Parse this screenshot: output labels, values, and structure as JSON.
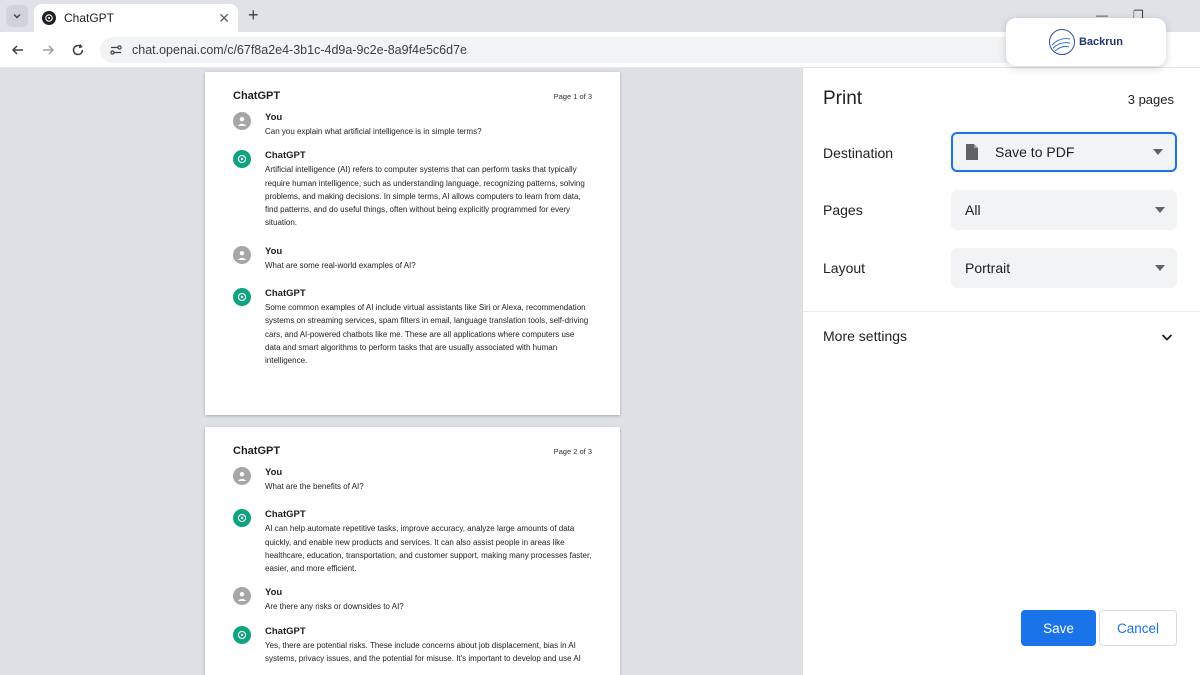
{
  "browser": {
    "tab_title": "ChatGPT",
    "close_glyph": "✕",
    "new_tab_glyph": "+",
    "url": "chat.openai.com/c/67f8a2e4-3b1c-4d9a-9c2e-8a9f4e5c6d7e",
    "minimize_glyph": "—",
    "restore_glyph": "❐"
  },
  "overlay": {
    "brand": "Backrun"
  },
  "preview": {
    "pages": [
      {
        "title": "ChatGPT",
        "page_label": "Page 1 of 3",
        "messages": [
          {
            "author": "You",
            "role": "user",
            "text": "Can you explain what artificial intelligence is in simple terms?"
          },
          {
            "author": "ChatGPT",
            "role": "assistant",
            "text": "Artificial intelligence (AI) refers to computer systems that can perform tasks that typically require human intelligence, such as understanding language, recognizing patterns, solving problems, and making decisions. In simple terms, AI allows computers to learn from data, find patterns, and do useful things, often without being explicitly programmed for every situation."
          },
          {
            "author": "You",
            "role": "user",
            "text": "What are some real-world examples of AI?"
          },
          {
            "author": "ChatGPT",
            "role": "assistant",
            "text": "Some common examples of AI include virtual assistants like Siri or Alexa, recommendation systems on streaming services, spam filters in email, language translation tools, self-driving cars, and AI-powered chatbots like me. These are all applications where computers use data and smart algorithms to perform tasks that are usually associated with human intelligence."
          }
        ]
      },
      {
        "title": "ChatGPT",
        "page_label": "Page 2 of 3",
        "messages": [
          {
            "author": "You",
            "role": "user",
            "text": "What are the benefits of AI?"
          },
          {
            "author": "ChatGPT",
            "role": "assistant",
            "text": "AI can help automate repetitive tasks, improve accuracy, analyze large amounts of data quickly, and enable new products and services. It can also assist people in areas like healthcare, education, transportation, and customer support, making many processes faster, easier, and more efficient."
          },
          {
            "author": "You",
            "role": "user",
            "text": "Are there any risks or downsides to AI?"
          },
          {
            "author": "ChatGPT",
            "role": "assistant",
            "text": "Yes, there are potential risks. These include concerns about job displacement, bias in AI systems, privacy issues, and the potential for misuse. It's important to develop and use AI"
          }
        ]
      }
    ]
  },
  "print_panel": {
    "title": "Print",
    "page_count": "3 pages",
    "destination": {
      "label": "Destination",
      "value": "Save to PDF"
    },
    "pages": {
      "label": "Pages",
      "value": "All"
    },
    "layout": {
      "label": "Layout",
      "value": "Portrait"
    },
    "more_settings": "More settings",
    "save_label": "Save",
    "cancel_label": "Cancel"
  },
  "colors": {
    "accent": "#1a73e8",
    "chatgpt_green": "#10a37f",
    "user_avatar": "#a6a6a6"
  }
}
